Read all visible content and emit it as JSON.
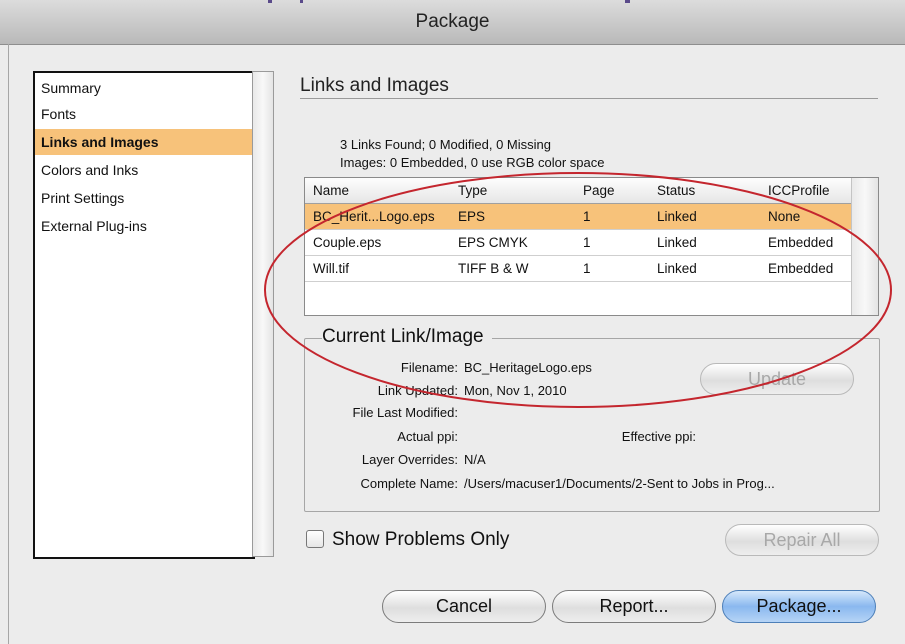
{
  "window": {
    "title": "Package"
  },
  "sidebar": {
    "items": [
      {
        "label": "Summary"
      },
      {
        "label": "Fonts"
      },
      {
        "label": "Links and Images",
        "selected": true
      },
      {
        "label": "Colors and Inks"
      },
      {
        "label": "Print Settings"
      },
      {
        "label": "External Plug-ins"
      }
    ]
  },
  "section": {
    "title": "Links and Images",
    "summary_links": "3 Links Found; 0 Modified, 0 Missing",
    "summary_images": "Images: 0 Embedded, 0 use RGB color space"
  },
  "table": {
    "headers": {
      "name": "Name",
      "type": "Type",
      "page": "Page",
      "status": "Status",
      "icc": "ICCProfile"
    },
    "rows": [
      {
        "name": "BC_Herit...Logo.eps",
        "type": "EPS",
        "page": "1",
        "status": "Linked",
        "icc": "None",
        "selected": true
      },
      {
        "name": "Couple.eps",
        "type": "EPS CMYK",
        "page": "1",
        "status": "Linked",
        "icc": "Embedded"
      },
      {
        "name": "Will.tif",
        "type": "TIFF B & W",
        "page": "1",
        "status": "Linked",
        "icc": "Embedded"
      }
    ]
  },
  "current": {
    "title": "Current Link/Image",
    "filename_label": "Filename:",
    "filename_value": "BC_HeritageLogo.eps",
    "link_updated_label": "Link Updated:",
    "link_updated_value": "Mon, Nov 1, 2010",
    "last_modified_label": "File Last Modified:",
    "last_modified_value": "",
    "actual_ppi_label": "Actual ppi:",
    "actual_ppi_value": "",
    "effective_ppi_label": "Effective ppi:",
    "effective_ppi_value": "",
    "layer_overrides_label": "Layer Overrides:",
    "layer_overrides_value": "N/A",
    "complete_name_label": "Complete Name:",
    "complete_name_value": "/Users/macuser1/Documents/2-Sent to Jobs in Prog...",
    "update_button": "Update"
  },
  "options": {
    "show_problems_label": "Show Problems Only",
    "show_problems_checked": false
  },
  "buttons": {
    "repair_all": "Repair All",
    "cancel": "Cancel",
    "report": "Report...",
    "package": "Package..."
  },
  "colors": {
    "selection": "#f7c27a",
    "annotation": "#c4262e",
    "default_button": "#8ab8ef"
  }
}
